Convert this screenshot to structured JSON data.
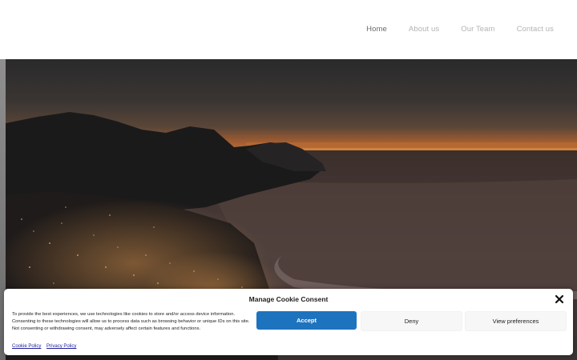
{
  "nav": {
    "items": [
      {
        "label": "Home"
      },
      {
        "label": "About us"
      },
      {
        "label": "Our Team"
      },
      {
        "label": "Contact us"
      }
    ],
    "active_index": 0
  },
  "hero": {
    "description": "Dusk photo of coastal mountains and city lights beside the ocean"
  },
  "cookie_banner": {
    "title": "Manage Cookie Consent",
    "body": "To provide the best experiences, we use technologies like cookies to store and/or access device information. Consenting to these technologies will allow us to process data such as browsing behavior or unique IDs on this site. Not consenting or withdrawing consent, may adversely affect certain features and functions.",
    "accept_label": "Accept",
    "deny_label": "Deny",
    "preferences_label": "View preferences",
    "links": [
      {
        "label": "Cookie Policy"
      },
      {
        "label": "Privacy Policy"
      }
    ],
    "close_icon": "close-icon",
    "accent_color": "#1e73be"
  }
}
